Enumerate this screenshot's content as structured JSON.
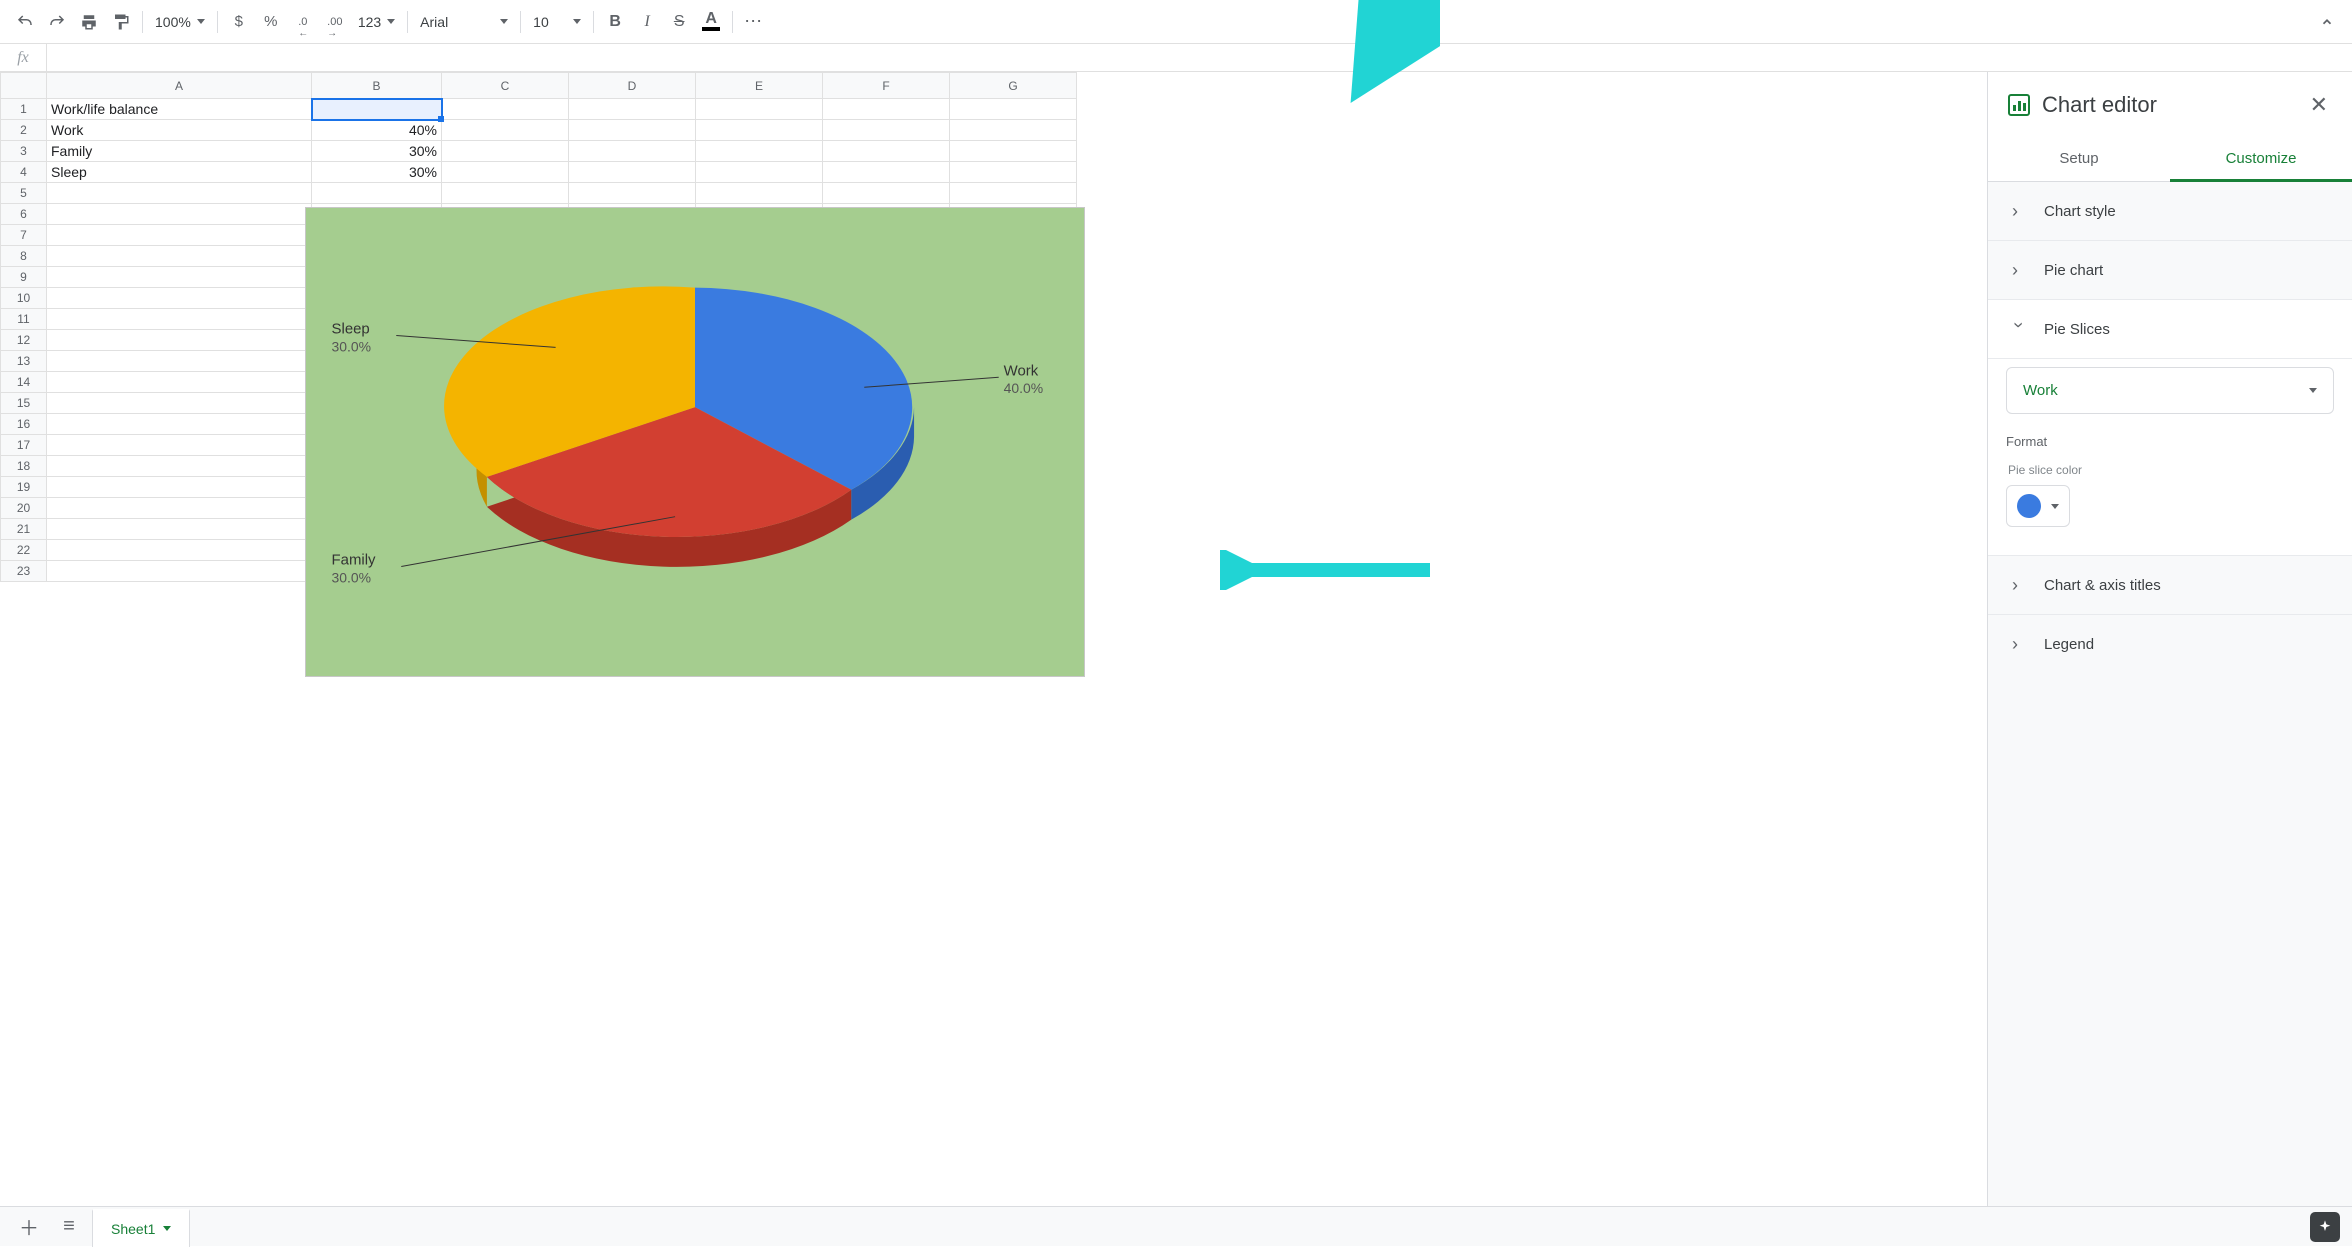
{
  "toolbar": {
    "zoom": "100%",
    "currency": "$",
    "percent": "%",
    "dec_minus": ".0",
    "dec_plus": ".00",
    "more_formats": "123",
    "font": "Arial",
    "font_size": "10",
    "bold": "B",
    "italic": "I",
    "strike": "S",
    "text_color": "A",
    "more": "⋯"
  },
  "formula": {
    "fx": "fx",
    "value": ""
  },
  "columns": [
    "A",
    "B",
    "C",
    "D",
    "E",
    "F",
    "G"
  ],
  "rows_count": 23,
  "cells": {
    "A1": "Work/life balance",
    "A2": "Work",
    "B2": "40%",
    "A3": "Family",
    "B3": "30%",
    "A4": "Sleep",
    "B4": "30%"
  },
  "chart_data": {
    "type": "pie",
    "title": "",
    "categories": [
      "Work",
      "Family",
      "Sleep"
    ],
    "values": [
      40,
      30,
      30
    ],
    "labels": [
      {
        "name": "Work",
        "pct": "40.0%"
      },
      {
        "name": "Family",
        "pct": "30.0%"
      },
      {
        "name": "Sleep",
        "pct": "30.0%"
      }
    ],
    "colors": {
      "Work": "#3a7be0",
      "Family": "#d23f31",
      "Sleep": "#f4b400"
    },
    "background": "#a5cd8f",
    "three_d": true
  },
  "editor": {
    "title": "Chart editor",
    "tabs": {
      "setup": "Setup",
      "customize": "Customize"
    },
    "sections": {
      "chart_style": "Chart style",
      "pie_chart": "Pie chart",
      "pie_slices": "Pie Slices",
      "chart_axis": "Chart & axis titles",
      "legend": "Legend"
    },
    "slice_selected": "Work",
    "format_label": "Format",
    "color_label": "Pie slice color",
    "slice_color": "#3a7be0"
  },
  "sheet_tabs": {
    "sheet1": "Sheet1"
  }
}
